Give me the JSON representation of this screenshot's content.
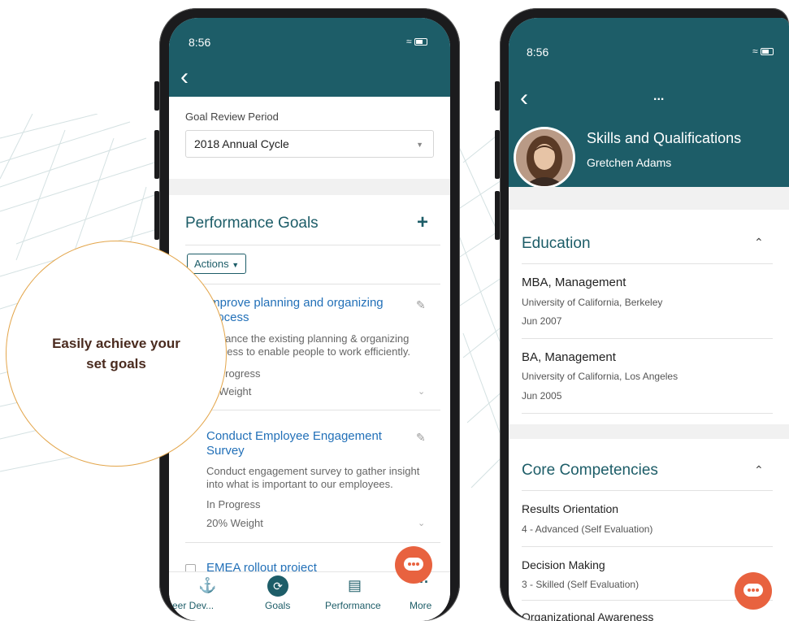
{
  "phone1": {
    "status_time": "8:56",
    "goal_review_period_label": "Goal Review Period",
    "goal_review_period_value": "2018 Annual Cycle",
    "section_title": "Performance Goals",
    "actions_label": "Actions",
    "goals": [
      {
        "title_line1": "Improve planning and organizing",
        "title_line2": "process",
        "desc_line1": "Enhance the existing planning & organizing",
        "desc_line2": "process to enable people to work efficiently.",
        "status": "In Progress",
        "weight": "% Weight"
      },
      {
        "title_line1": "Conduct Employee Engagement",
        "title_line2": "Survey",
        "desc_line1": "Conduct engagement survey to gather insight",
        "desc_line2": "into what is important to our employees.",
        "status": "In Progress",
        "weight": "20% Weight"
      },
      {
        "title_line1": "EMEA rollout project"
      }
    ],
    "tabs": [
      "reer Dev...",
      "Goals",
      "Performance",
      "More"
    ]
  },
  "callout": {
    "line1": "Easily achieve your",
    "line2": "set goals"
  },
  "phone2": {
    "status_time": "8:56",
    "more_label": "...",
    "title": "Skills and Qualifications",
    "person": "Gretchen Adams",
    "education_title": "Education",
    "education": [
      {
        "degree": "MBA, Management",
        "school": "University of California, Berkeley",
        "date": "Jun 2007"
      },
      {
        "degree": "BA, Management",
        "school": "University of California, Los Angeles",
        "date": "Jun 2005"
      }
    ],
    "competencies_title": "Core Competencies",
    "competencies": [
      {
        "name": "Results Orientation",
        "level": "4 - Advanced (Self Evaluation)"
      },
      {
        "name": "Decision Making",
        "level": "3 - Skilled (Self Evaluation)"
      },
      {
        "name": "Organizational Awareness"
      }
    ]
  },
  "colors": {
    "teal": "#1d5d68",
    "link_blue": "#2270b8",
    "chat_orange": "#e8623f",
    "callout_border": "#e3a54a"
  }
}
